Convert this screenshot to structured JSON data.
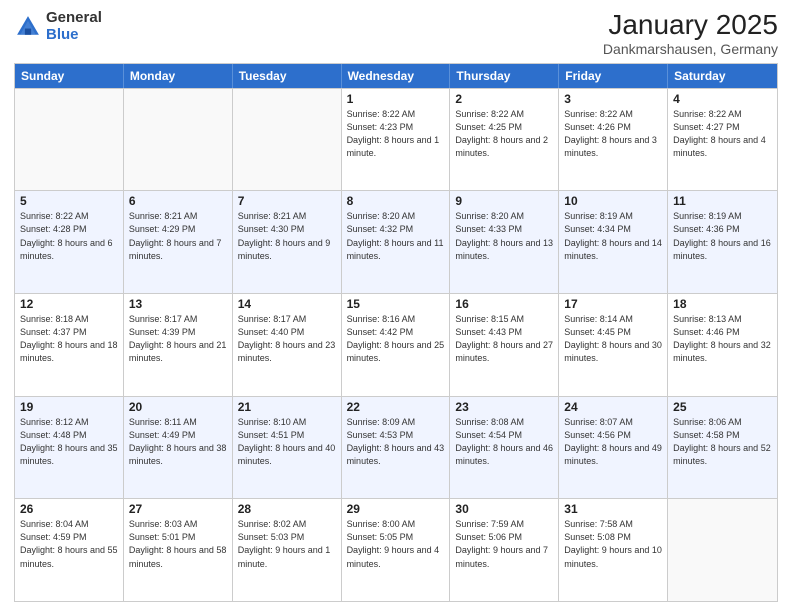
{
  "logo": {
    "general": "General",
    "blue": "Blue"
  },
  "title": "January 2025",
  "subtitle": "Dankmarshausen, Germany",
  "days": [
    "Sunday",
    "Monday",
    "Tuesday",
    "Wednesday",
    "Thursday",
    "Friday",
    "Saturday"
  ],
  "weeks": [
    [
      {
        "day": "",
        "info": ""
      },
      {
        "day": "",
        "info": ""
      },
      {
        "day": "",
        "info": ""
      },
      {
        "day": "1",
        "info": "Sunrise: 8:22 AM\nSunset: 4:23 PM\nDaylight: 8 hours\nand 1 minute."
      },
      {
        "day": "2",
        "info": "Sunrise: 8:22 AM\nSunset: 4:25 PM\nDaylight: 8 hours\nand 2 minutes."
      },
      {
        "day": "3",
        "info": "Sunrise: 8:22 AM\nSunset: 4:26 PM\nDaylight: 8 hours\nand 3 minutes."
      },
      {
        "day": "4",
        "info": "Sunrise: 8:22 AM\nSunset: 4:27 PM\nDaylight: 8 hours\nand 4 minutes."
      }
    ],
    [
      {
        "day": "5",
        "info": "Sunrise: 8:22 AM\nSunset: 4:28 PM\nDaylight: 8 hours\nand 6 minutes."
      },
      {
        "day": "6",
        "info": "Sunrise: 8:21 AM\nSunset: 4:29 PM\nDaylight: 8 hours\nand 7 minutes."
      },
      {
        "day": "7",
        "info": "Sunrise: 8:21 AM\nSunset: 4:30 PM\nDaylight: 8 hours\nand 9 minutes."
      },
      {
        "day": "8",
        "info": "Sunrise: 8:20 AM\nSunset: 4:32 PM\nDaylight: 8 hours\nand 11 minutes."
      },
      {
        "day": "9",
        "info": "Sunrise: 8:20 AM\nSunset: 4:33 PM\nDaylight: 8 hours\nand 13 minutes."
      },
      {
        "day": "10",
        "info": "Sunrise: 8:19 AM\nSunset: 4:34 PM\nDaylight: 8 hours\nand 14 minutes."
      },
      {
        "day": "11",
        "info": "Sunrise: 8:19 AM\nSunset: 4:36 PM\nDaylight: 8 hours\nand 16 minutes."
      }
    ],
    [
      {
        "day": "12",
        "info": "Sunrise: 8:18 AM\nSunset: 4:37 PM\nDaylight: 8 hours\nand 18 minutes."
      },
      {
        "day": "13",
        "info": "Sunrise: 8:17 AM\nSunset: 4:39 PM\nDaylight: 8 hours\nand 21 minutes."
      },
      {
        "day": "14",
        "info": "Sunrise: 8:17 AM\nSunset: 4:40 PM\nDaylight: 8 hours\nand 23 minutes."
      },
      {
        "day": "15",
        "info": "Sunrise: 8:16 AM\nSunset: 4:42 PM\nDaylight: 8 hours\nand 25 minutes."
      },
      {
        "day": "16",
        "info": "Sunrise: 8:15 AM\nSunset: 4:43 PM\nDaylight: 8 hours\nand 27 minutes."
      },
      {
        "day": "17",
        "info": "Sunrise: 8:14 AM\nSunset: 4:45 PM\nDaylight: 8 hours\nand 30 minutes."
      },
      {
        "day": "18",
        "info": "Sunrise: 8:13 AM\nSunset: 4:46 PM\nDaylight: 8 hours\nand 32 minutes."
      }
    ],
    [
      {
        "day": "19",
        "info": "Sunrise: 8:12 AM\nSunset: 4:48 PM\nDaylight: 8 hours\nand 35 minutes."
      },
      {
        "day": "20",
        "info": "Sunrise: 8:11 AM\nSunset: 4:49 PM\nDaylight: 8 hours\nand 38 minutes."
      },
      {
        "day": "21",
        "info": "Sunrise: 8:10 AM\nSunset: 4:51 PM\nDaylight: 8 hours\nand 40 minutes."
      },
      {
        "day": "22",
        "info": "Sunrise: 8:09 AM\nSunset: 4:53 PM\nDaylight: 8 hours\nand 43 minutes."
      },
      {
        "day": "23",
        "info": "Sunrise: 8:08 AM\nSunset: 4:54 PM\nDaylight: 8 hours\nand 46 minutes."
      },
      {
        "day": "24",
        "info": "Sunrise: 8:07 AM\nSunset: 4:56 PM\nDaylight: 8 hours\nand 49 minutes."
      },
      {
        "day": "25",
        "info": "Sunrise: 8:06 AM\nSunset: 4:58 PM\nDaylight: 8 hours\nand 52 minutes."
      }
    ],
    [
      {
        "day": "26",
        "info": "Sunrise: 8:04 AM\nSunset: 4:59 PM\nDaylight: 8 hours\nand 55 minutes."
      },
      {
        "day": "27",
        "info": "Sunrise: 8:03 AM\nSunset: 5:01 PM\nDaylight: 8 hours\nand 58 minutes."
      },
      {
        "day": "28",
        "info": "Sunrise: 8:02 AM\nSunset: 5:03 PM\nDaylight: 9 hours\nand 1 minute."
      },
      {
        "day": "29",
        "info": "Sunrise: 8:00 AM\nSunset: 5:05 PM\nDaylight: 9 hours\nand 4 minutes."
      },
      {
        "day": "30",
        "info": "Sunrise: 7:59 AM\nSunset: 5:06 PM\nDaylight: 9 hours\nand 7 minutes."
      },
      {
        "day": "31",
        "info": "Sunrise: 7:58 AM\nSunset: 5:08 PM\nDaylight: 9 hours\nand 10 minutes."
      },
      {
        "day": "",
        "info": ""
      }
    ]
  ]
}
